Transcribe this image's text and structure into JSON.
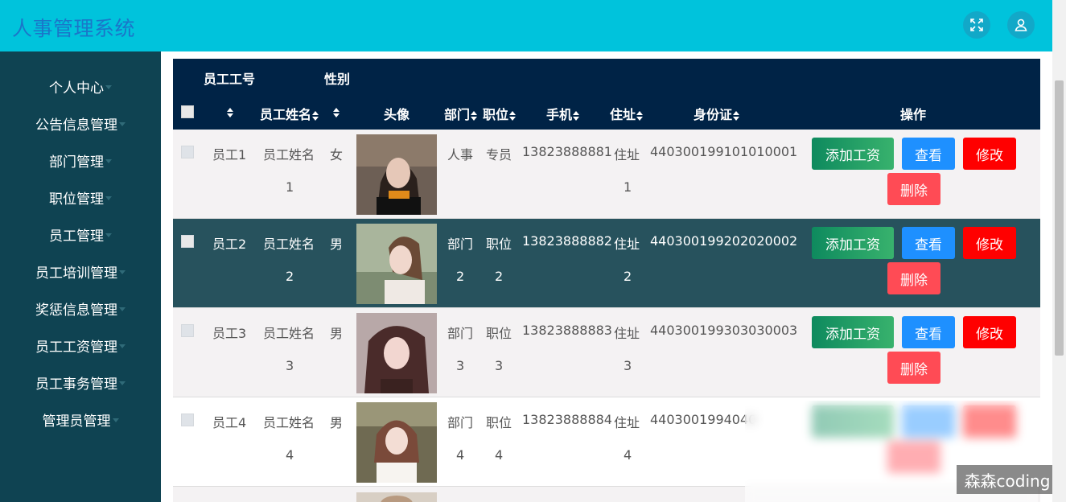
{
  "app": {
    "title": "人事管理系统"
  },
  "header": {
    "icons": [
      "fullscreen-icon",
      "user-icon"
    ]
  },
  "sidebar": {
    "items": [
      {
        "label": "个人中心"
      },
      {
        "label": "公告信息管理"
      },
      {
        "label": "部门管理"
      },
      {
        "label": "职位管理"
      },
      {
        "label": "员工管理"
      },
      {
        "label": "员工培训管理"
      },
      {
        "label": "奖惩信息管理"
      },
      {
        "label": "员工工资管理"
      },
      {
        "label": "员工事务管理"
      },
      {
        "label": "管理员管理"
      }
    ]
  },
  "table": {
    "headers": {
      "employee_no": "员工工号",
      "gender": "性别",
      "name": "员工姓名",
      "avatar": "头像",
      "dept": "部门",
      "position": "职位",
      "phone": "手机",
      "address": "住址",
      "id_card": "身份证",
      "actions": "操作"
    },
    "buttons": {
      "salary": "添加工资",
      "view": "查看",
      "edit": "修改",
      "delete": "删除"
    },
    "rows": [
      {
        "no": "员工1",
        "name1": "员工姓名",
        "name2": "1",
        "gender": "女",
        "dept1": "人事",
        "dept2": "",
        "pos1": "专员",
        "pos2": "",
        "phone": "13823888881",
        "addr1": "住址",
        "addr2": "1",
        "id": "440300199101010001"
      },
      {
        "no": "员工2",
        "name1": "员工姓名",
        "name2": "2",
        "gender": "男",
        "dept1": "部门",
        "dept2": "2",
        "pos1": "职位",
        "pos2": "2",
        "phone": "13823888882",
        "addr1": "住址",
        "addr2": "2",
        "id": "440300199202020002"
      },
      {
        "no": "员工3",
        "name1": "员工姓名",
        "name2": "3",
        "gender": "男",
        "dept1": "部门",
        "dept2": "3",
        "pos1": "职位",
        "pos2": "3",
        "phone": "13823888883",
        "addr1": "住址",
        "addr2": "3",
        "id": "440300199303030003"
      },
      {
        "no": "员工4",
        "name1": "员工姓名",
        "name2": "4",
        "gender": "男",
        "dept1": "部门",
        "dept2": "4",
        "pos1": "职位",
        "pos2": "4",
        "phone": "13823888884",
        "addr1": "住址",
        "addr2": "4",
        "id": "4403001994040"
      }
    ]
  },
  "watermark": "森森coding"
}
